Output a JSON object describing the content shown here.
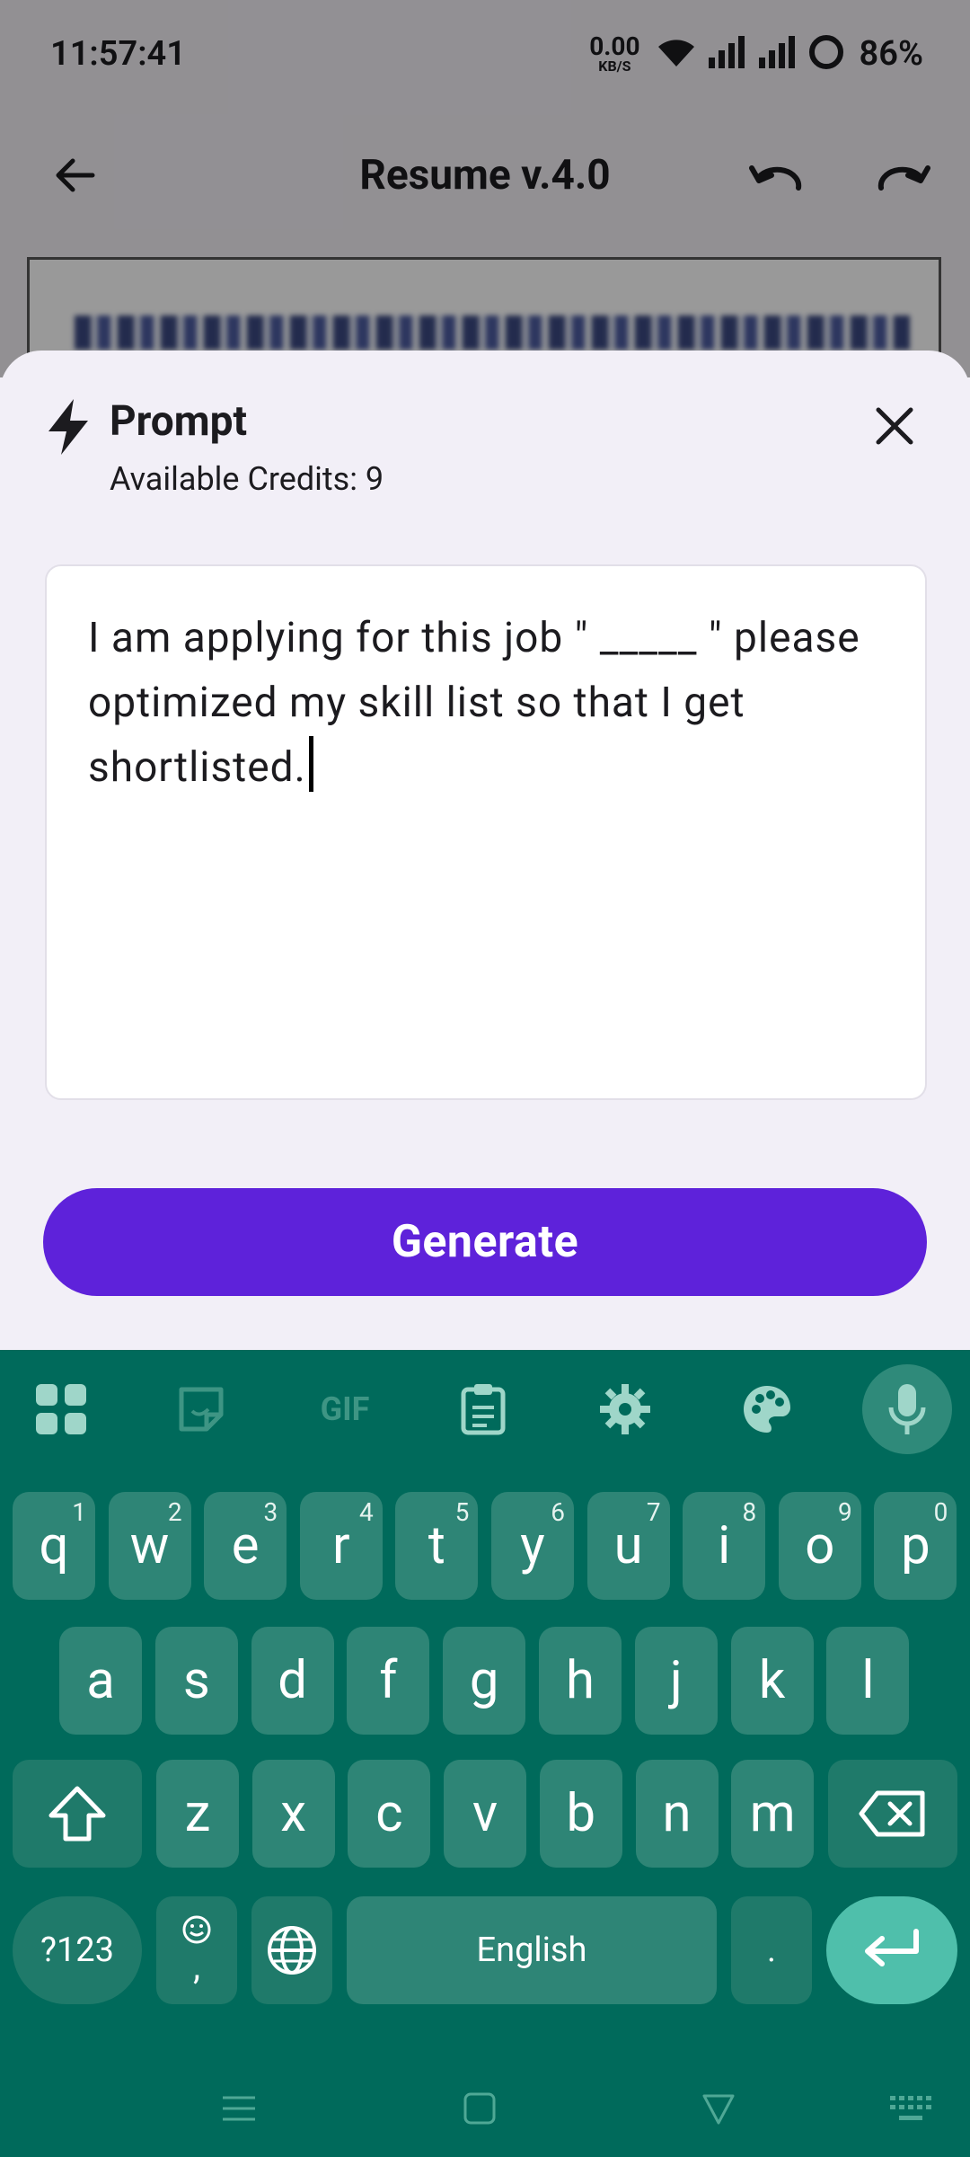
{
  "status_bar": {
    "time": "11:57:41",
    "net_speed_value": "0.00",
    "net_speed_unit": "KB/S",
    "battery": "86%"
  },
  "app_bar": {
    "title": "Resume v.4.0",
    "back_icon": "arrow-back-icon",
    "undo_icon": "undo-icon",
    "redo_icon": "redo-icon"
  },
  "sheet": {
    "title": "Prompt",
    "credits": "Available Credits: 9",
    "prompt_value": "I am applying for this job \" _____ \" please optimized my skill list so that I get shortlisted.",
    "generate_label": "Generate",
    "accent": "#5e22da"
  },
  "keyboard": {
    "toolbar_icons": [
      "apps-grid-icon",
      "sticker-icon",
      "gif-icon",
      "clipboard-icon",
      "settings-icon",
      "palette-icon",
      "mic-icon"
    ],
    "gif_label": "GIF",
    "row1": [
      {
        "k": "q",
        "h": "1"
      },
      {
        "k": "w",
        "h": "2"
      },
      {
        "k": "e",
        "h": "3"
      },
      {
        "k": "r",
        "h": "4"
      },
      {
        "k": "t",
        "h": "5"
      },
      {
        "k": "y",
        "h": "6"
      },
      {
        "k": "u",
        "h": "7"
      },
      {
        "k": "i",
        "h": "8"
      },
      {
        "k": "o",
        "h": "9"
      },
      {
        "k": "p",
        "h": "0"
      }
    ],
    "row2": [
      "a",
      "s",
      "d",
      "f",
      "g",
      "h",
      "j",
      "k",
      "l"
    ],
    "row3": [
      "z",
      "x",
      "c",
      "v",
      "b",
      "n",
      "m"
    ],
    "symbols_label": "?123",
    "emoji_comma": ",",
    "space_label": "English",
    "period_label": ".",
    "background": "#006a5b",
    "key_color": "#2e8576"
  }
}
